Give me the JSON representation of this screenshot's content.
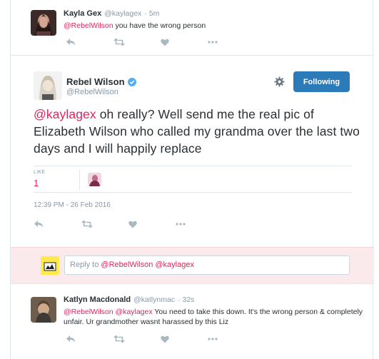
{
  "kayla": {
    "name": "Kayla Gex",
    "handle": "@kaylagex",
    "time": "· 5m",
    "mention": "@RebelWilson",
    "text": " you have the wrong person"
  },
  "main": {
    "name": "Rebel Wilson",
    "handle": "@RebelWilson",
    "follow_label": "Following",
    "mention": "@kaylagex",
    "text": " oh really? Well send me the real pic of Elizabeth Wilson who called my grandma over the last two days and I will happily replace",
    "like_label": "LIKE",
    "like_count": "1",
    "timestamp": "12:39 PM - 26 Feb 2016"
  },
  "reply_box": {
    "prefix": "Reply to ",
    "mentions": "@RebelWilson @kaylagex"
  },
  "katlyn": {
    "name": "Katlyn Macdonald",
    "handle": "@katlynmac",
    "time": "· 32s",
    "mentions": "@RebelWilson @kaylagex",
    "text": " You need to take this down. It's the wrong person & completely unfair. Ur grandmother wasnt harassed by this Liz"
  },
  "colors": {
    "accent": "#2b7bb9",
    "mention": "#e0245e",
    "muted": "#8899a6",
    "reply_bg": "#fbeaec"
  },
  "icons": [
    "reply-icon",
    "retweet-icon",
    "like-icon",
    "more-icon",
    "gear-icon",
    "verified-icon"
  ]
}
